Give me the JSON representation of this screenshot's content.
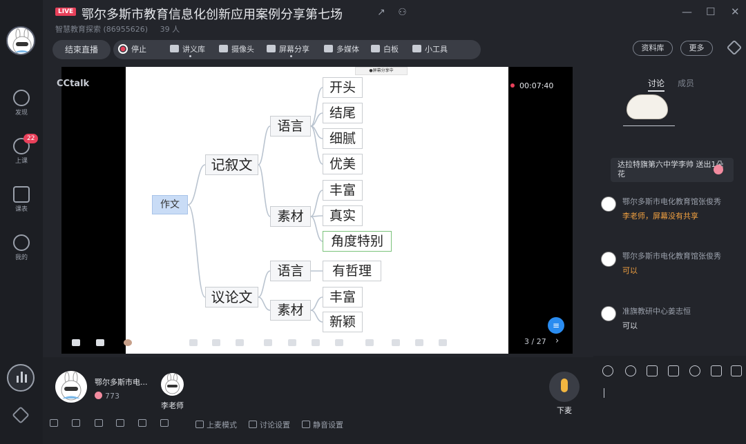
{
  "header": {
    "live_tag": "LIVE",
    "title": "鄂尔多斯市教育信息化创新应用案例分享第七场",
    "channel": "智慧教育探索 (86955626)",
    "count": "39 人",
    "share_icon": "↗",
    "person_icon": "⚇",
    "minimize": "—",
    "maximize": "☐",
    "close": "✕"
  },
  "rail": {
    "discover": "发现",
    "class": "上课",
    "class_badge": "22",
    "schedule": "课表",
    "mine": "我的"
  },
  "toolbar": {
    "end_live": "结束直播",
    "stop": "停止",
    "lecture": "讲义库",
    "camera": "摄像头",
    "screen_share": "屏幕分享",
    "multimedia": "多媒体",
    "whiteboard": "白板",
    "tools": "小工具",
    "resources": "资料库",
    "more": "更多"
  },
  "stage": {
    "brand": "CCtalk",
    "timer": "00:07:40",
    "slide_tag": "●屏幕分享中",
    "page": "3 / 27",
    "next": "›",
    "mindmap": {
      "root": "作文",
      "branches": [
        {
          "label": "记叙文",
          "children": [
            {
              "label": "语言",
              "leaves": [
                "开头",
                "结尾",
                "细腻",
                "优美"
              ]
            },
            {
              "label": "素材",
              "leaves": [
                "丰富",
                "真实",
                "角度特别"
              ]
            }
          ]
        },
        {
          "label": "议论文",
          "children": [
            {
              "label": "语言",
              "leaves": [
                "有哲理"
              ]
            },
            {
              "label": "素材",
              "leaves": [
                "丰富",
                "新颖"
              ]
            }
          ]
        }
      ]
    }
  },
  "bottom": {
    "host_name": "鄂尔多斯市电...",
    "flowers": "773",
    "guest_name": "李老师",
    "leave_mic": "下麦",
    "mic_mode": "上麦模式",
    "discussion_settings": "讨论设置",
    "mute_settings": "静音设置"
  },
  "right": {
    "tab_discussion": "讨论",
    "tab_members": "成员",
    "gift_text": "达拉特旗第六中学李帅 送出1朵花",
    "messages": [
      {
        "name": "鄂尔多斯市电化教育馆张俊秀",
        "text": "李老师，屏幕没有共享",
        "style": "orange"
      },
      {
        "name": "鄂尔多斯市电化教育馆张俊秀",
        "text": "可以",
        "style": "orange"
      },
      {
        "name": "准旗教研中心姜志恒",
        "text": "可以",
        "style": "plain"
      }
    ]
  }
}
